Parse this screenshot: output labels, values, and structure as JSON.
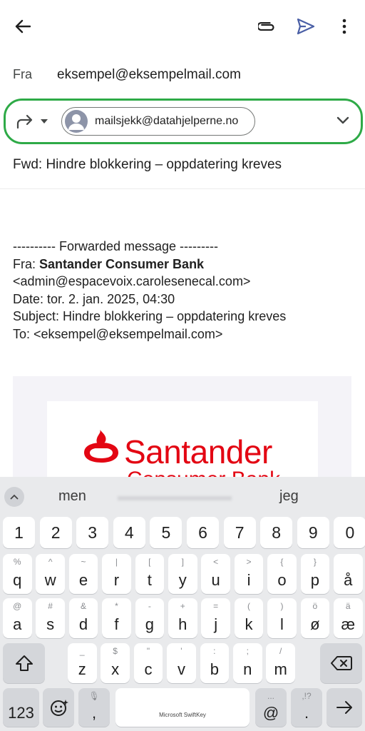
{
  "header": {
    "back_icon": "arrow-left-icon",
    "attach_icon": "paperclip-icon",
    "send_icon": "send-icon",
    "more_icon": "more-vertical-icon"
  },
  "from": {
    "label": "Fra",
    "address": "eksempel@eksempelmail.com"
  },
  "to": {
    "recipient": "mailsjekk@datahjelperne.no",
    "highlight_color": "#2eaa47"
  },
  "subject": "Fwd: Hindre blokkering – oppdatering kreves",
  "body": {
    "forward_header": "---------- Forwarded message ---------",
    "from_label": "Fra: ",
    "from_name": "Santander Consumer Bank",
    "from_email": "<admin@espacevoix.carolesenecal.com>",
    "date": "Date: tor. 2. jan. 2025, 04:30",
    "subject": "Subject: Hindre blokkering – oppdatering kreves",
    "to": "To: <eksempel@eksempelmail.com>"
  },
  "logo": {
    "name": "Santander",
    "sub": "Consumer Bank",
    "color": "#e30613"
  },
  "keyboard": {
    "suggestions": [
      "men",
      "jeg"
    ],
    "numbers": [
      "1",
      "2",
      "3",
      "4",
      "5",
      "6",
      "7",
      "8",
      "9",
      "0"
    ],
    "row1": [
      {
        "k": "q",
        "s": "%"
      },
      {
        "k": "w",
        "s": "^"
      },
      {
        "k": "e",
        "s": "~"
      },
      {
        "k": "r",
        "s": "|"
      },
      {
        "k": "t",
        "s": "["
      },
      {
        "k": "y",
        "s": "]"
      },
      {
        "k": "u",
        "s": "<"
      },
      {
        "k": "i",
        "s": ">"
      },
      {
        "k": "o",
        "s": "{"
      },
      {
        "k": "p",
        "s": "}"
      },
      {
        "k": "å",
        "s": ""
      }
    ],
    "row2": [
      {
        "k": "a",
        "s": "@"
      },
      {
        "k": "s",
        "s": "#"
      },
      {
        "k": "d",
        "s": "&"
      },
      {
        "k": "f",
        "s": "*"
      },
      {
        "k": "g",
        "s": "-"
      },
      {
        "k": "h",
        "s": "+"
      },
      {
        "k": "j",
        "s": "="
      },
      {
        "k": "k",
        "s": "("
      },
      {
        "k": "l",
        "s": ")"
      },
      {
        "k": "ø",
        "s": "ö"
      },
      {
        "k": "æ",
        "s": "ä"
      }
    ],
    "row3": [
      {
        "k": "z",
        "s": "_"
      },
      {
        "k": "x",
        "s": "$"
      },
      {
        "k": "c",
        "s": "\""
      },
      {
        "k": "v",
        "s": "'"
      },
      {
        "k": "b",
        "s": ":"
      },
      {
        "k": "n",
        "s": ";"
      },
      {
        "k": "m",
        "s": "/"
      }
    ],
    "sym_label": "123",
    "comma": ",",
    "space_label": "Microsoft SwiftKey",
    "at": "@",
    "at_sub": "...",
    "period": ".",
    "period_sub": ",!?"
  }
}
